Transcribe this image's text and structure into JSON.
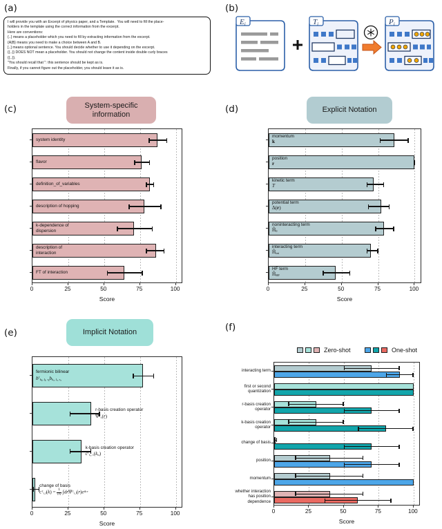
{
  "panels": {
    "a": {
      "letter": "(a)",
      "prompt_lines": [
        "I will provide you with an Excerpt of physics paper, and a Template.  You will need to fill the place-",
        "holders in the template using the correct information from the excerpt.",
        "Here are conventions:",
        "{..} means a placeholder which you need to fill by extracting information from the excerpt.",
        "{A|B} means you need to make a choice between A and B.",
        "[..] means optional sentence. You should decide whether to use it depending on the excerpt.",
        "{{..}} DOES NOT mean a placeholder. You should not change the content inside double curly braces",
        "{{..}}.",
        "\"You should recall that \": this sentence should be kept as is.",
        "Finally, if you cannot figure out the placeholder, you should leave it as is."
      ]
    },
    "b": {
      "letter": "(b)",
      "excerpt_label": "E",
      "excerpt_sub": "i",
      "template_label": "T",
      "template_sub": "i",
      "output_label": "P",
      "output_sub": "i",
      "plus": "+",
      "model_icon": "llm-snowflake-icon",
      "arrow_icon": "arrow-right-icon"
    },
    "c": {
      "letter": "(c)",
      "title": "System-specific\ninformation",
      "title_line1": "System-specific",
      "title_line2": "information",
      "pill_color": "#d9afb0",
      "bar_color": "#dfb3b4"
    },
    "d": {
      "letter": "(d)",
      "title": "Explicit Notation",
      "pill_color": "#b2ccd1",
      "bar_color": "#b4ccd0"
    },
    "e": {
      "letter": "(e)",
      "title": "Implicit Notation",
      "pill_color": "#9fe0d8",
      "bar_color": "#a6e2da"
    },
    "f": {
      "letter": "(f)",
      "legend": [
        {
          "label": "Zero-shot",
          "swatches": [
            "#b4ccd0",
            "#a6e2da",
            "#dfb3b4"
          ]
        },
        {
          "label": "One-shot",
          "swatches": [
            "#4da6e8",
            "#12a5ab",
            "#ea6a62"
          ]
        }
      ]
    }
  },
  "chart_data": [
    {
      "id": "panel-c",
      "type": "bar",
      "orientation": "horizontal",
      "title": "System-specific information",
      "xlabel": "Score",
      "ylabel": "",
      "xlim": [
        0,
        105
      ],
      "xticks": [
        0,
        25,
        50,
        75,
        100
      ],
      "grid": true,
      "bar_color": "#dfb3b4",
      "categories": [
        "system identity",
        "flavor",
        "definition_of_variables",
        "description of hopping",
        "k-dependence of dispersion",
        "description of interaction",
        "FT of interaction"
      ],
      "values": [
        87,
        76,
        82,
        78,
        71,
        86,
        64
      ],
      "err_low": [
        81,
        71,
        79,
        67,
        59,
        79,
        52
      ],
      "err_high": [
        94,
        82,
        85,
        90,
        84,
        92,
        77
      ]
    },
    {
      "id": "panel-d",
      "type": "bar",
      "orientation": "horizontal",
      "title": "Explicit Notation",
      "xlabel": "Score",
      "ylabel": "",
      "xlim": [
        0,
        105
      ],
      "xticks": [
        0,
        25,
        50,
        75,
        100
      ],
      "grid": true,
      "bar_color": "#b4ccd0",
      "categories": [
        "momentum k",
        "position r",
        "kinetic term T",
        "potential term Δ(r)",
        "noninteracting term H₀",
        "interacting term H_int",
        "HF term H_HF"
      ],
      "category_labels": [
        {
          "line1": "momentum",
          "line2": "k"
        },
        {
          "line1": "position",
          "line2": "r"
        },
        {
          "line1": "kinetic term",
          "line2": "T"
        },
        {
          "line1": "potential term",
          "line2": "Δ(r)"
        },
        {
          "line1": "noninteracting term",
          "line2": "Ĥ₀"
        },
        {
          "line1": "interacting term",
          "line2": "Ĥint"
        },
        {
          "line1": "HF term",
          "line2": "ĤHF"
        }
      ],
      "values": [
        86,
        100,
        72,
        77,
        79,
        70,
        46
      ],
      "err_low": [
        76,
        100,
        67,
        68,
        73,
        67,
        37
      ],
      "err_high": [
        96,
        100,
        79,
        83,
        86,
        75,
        56
      ]
    },
    {
      "id": "panel-e",
      "type": "bar",
      "orientation": "horizontal",
      "title": "Implicit Notation",
      "xlabel": "Score",
      "ylabel": "",
      "xlim": [
        0,
        105
      ],
      "xticks": [
        0,
        25,
        50,
        75,
        100
      ],
      "grid": true,
      "bar_color": "#a6e2da",
      "categories": [
        "fermionic bilinear",
        "r-basis creation operator",
        "k-basis creation operator",
        "change of basis"
      ],
      "category_labels": [
        {
          "line1": "fermionic bilinear",
          "line2": "b†kβ, lβ, τβ bkα, lα, τα",
          "inside": true
        },
        {
          "line1": "r-basis creation operator",
          "line2": "Ψ†τ(r)",
          "inside": false
        },
        {
          "line1": "k-basis creation operator",
          "line2": "c†lα, τ(kα)",
          "inside": false
        },
        {
          "line1": "change of basis",
          "line2": "c†τ,l(k) = (1/√V) ∫ dr Ψ†τ,l(r) e^{ik·r}",
          "inside": false
        }
      ],
      "values": [
        77,
        41,
        34,
        2
      ],
      "err_low": [
        70,
        26,
        26,
        0
      ],
      "err_high": [
        85,
        47,
        41,
        5
      ]
    },
    {
      "id": "panel-f",
      "type": "bar",
      "orientation": "horizontal",
      "grouped": true,
      "title": "",
      "xlabel": "Score",
      "ylabel": "",
      "xlim": [
        0,
        105
      ],
      "xticks": [
        0,
        25,
        50,
        75,
        100
      ],
      "grid": true,
      "categories": [
        "interacting term",
        "first or second quantization",
        "r-basis creation operator",
        "k-basis creation operator",
        "change of basis",
        "position",
        "momentum",
        "whether interaction has position dependence"
      ],
      "category_lines": [
        [
          "interacting term"
        ],
        [
          "first or second",
          "quantization"
        ],
        [
          "r-basis creation",
          "operator"
        ],
        [
          "k-basis creation",
          "operator"
        ],
        [
          "change of basis"
        ],
        [
          "position"
        ],
        [
          "momentum"
        ],
        [
          "whether interaction",
          "has position",
          "dependence"
        ]
      ],
      "group_colors": [
        {
          "zero": "#b4ccd0",
          "one": "#4da6e8"
        },
        {
          "zero": "#a6e2da",
          "one": "#12a5ab"
        },
        {
          "zero": "#a6e2da",
          "one": "#12a5ab"
        },
        {
          "zero": "#a6e2da",
          "one": "#12a5ab"
        },
        {
          "zero": "#a6e2da",
          "one": "#12a5ab"
        },
        {
          "zero": "#b4ccd0",
          "one": "#4da6e8"
        },
        {
          "zero": "#b4ccd0",
          "one": "#4da6e8"
        },
        {
          "zero": "#dfb3b4",
          "one": "#ea6a62"
        }
      ],
      "series": [
        {
          "name": "Zero-shot",
          "values": [
            70,
            100,
            30,
            30,
            1,
            40,
            40,
            40
          ],
          "err_low": [
            50,
            100,
            10,
            10,
            0,
            15,
            15,
            15
          ],
          "err_high": [
            90,
            100,
            50,
            50,
            2,
            64,
            64,
            64
          ]
        },
        {
          "name": "One-shot",
          "values": [
            90,
            100,
            70,
            80,
            70,
            70,
            100,
            60
          ],
          "err_low": [
            80,
            100,
            50,
            60,
            50,
            50,
            100,
            36
          ],
          "err_high": [
            100,
            100,
            90,
            100,
            90,
            90,
            100,
            84
          ]
        }
      ]
    }
  ]
}
